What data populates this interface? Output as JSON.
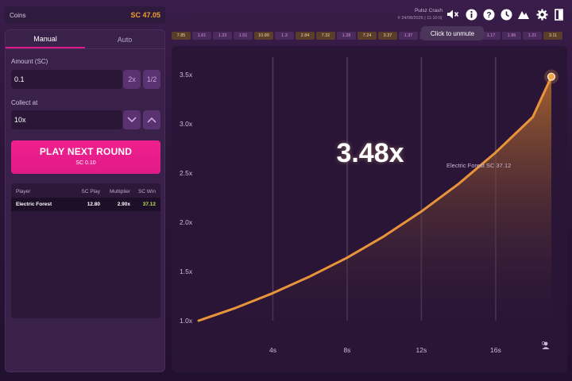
{
  "wallet": {
    "label": "Coins",
    "balance": "SC 47.05"
  },
  "mode_tabs": [
    {
      "label": "Manual",
      "active": true
    },
    {
      "label": "Auto",
      "active": false
    }
  ],
  "amount": {
    "label": "Amount (SC)",
    "value": "0.1",
    "double": "2x",
    "half": "1/2"
  },
  "collect": {
    "label": "Collect at",
    "value": "10x"
  },
  "play_button": {
    "label": "PLAY NEXT ROUND",
    "sub": "SC 0.10"
  },
  "bets_table": {
    "headers": [
      "Player",
      "SC Play",
      "Multiplier",
      "SC Win"
    ],
    "rows": [
      {
        "player": "Electric Forest",
        "play": "12.80",
        "multiplier": "2.90x",
        "win": "37.12"
      }
    ]
  },
  "header": {
    "title": "Pulsz Crash",
    "subtitle": "# 24/08/2026 | 11:10:0(",
    "icons": [
      "mute-icon",
      "info-icon",
      "help-icon",
      "history-icon",
      "leaderboard-icon",
      "settings-icon",
      "exit-icon"
    ],
    "tooltip": "Click to unmute"
  },
  "history": [
    {
      "value": "7.85",
      "tone": "gold"
    },
    {
      "value": "1.61",
      "tone": "purple"
    },
    {
      "value": "1.23",
      "tone": "purple"
    },
    {
      "value": "1.51",
      "tone": "purple"
    },
    {
      "value": "10.80",
      "tone": "gold"
    },
    {
      "value": "1.3",
      "tone": "purple"
    },
    {
      "value": "2.84",
      "tone": "gold"
    },
    {
      "value": "7.32",
      "tone": "gold"
    },
    {
      "value": "1.28",
      "tone": "purple"
    },
    {
      "value": "7.24",
      "tone": "gold"
    },
    {
      "value": "3.37",
      "tone": "gold"
    },
    {
      "value": "1.37",
      "tone": "purple"
    },
    {
      "value": "",
      "tone": "purple"
    },
    {
      "value": "",
      "tone": "purple"
    },
    {
      "value": "",
      "tone": "purple"
    },
    {
      "value": "1.17",
      "tone": "purple"
    },
    {
      "value": "1.96",
      "tone": "purple"
    },
    {
      "value": "1.21",
      "tone": "purple"
    },
    {
      "value": "3.11",
      "tone": "gold"
    }
  ],
  "round": {
    "multiplier": "3.48x",
    "cashout_label": "Electric Forest SC 37.12",
    "players_online": "0"
  },
  "chart_data": {
    "type": "area",
    "title": "",
    "xlabel": "",
    "ylabel": "",
    "x_ticks": [
      "4s",
      "8s",
      "12s",
      "16s"
    ],
    "y_ticks": [
      "1.0x",
      "1.5x",
      "2.0x",
      "2.5x",
      "3.0x",
      "3.5x"
    ],
    "xlim": [
      0,
      19
    ],
    "ylim": [
      1.0,
      3.55
    ],
    "series": [
      {
        "values_x": [
          0,
          2,
          4,
          6,
          8,
          10,
          12,
          14,
          16,
          18,
          19
        ],
        "values_y": [
          1.0,
          1.13,
          1.28,
          1.45,
          1.64,
          1.86,
          2.11,
          2.39,
          2.71,
          3.07,
          3.48
        ]
      }
    ],
    "colors": {
      "line": "#e8943a",
      "fill_top": "#a8642e",
      "fill_bottom": "#2a1537",
      "grid": "#5c4b6a"
    }
  }
}
